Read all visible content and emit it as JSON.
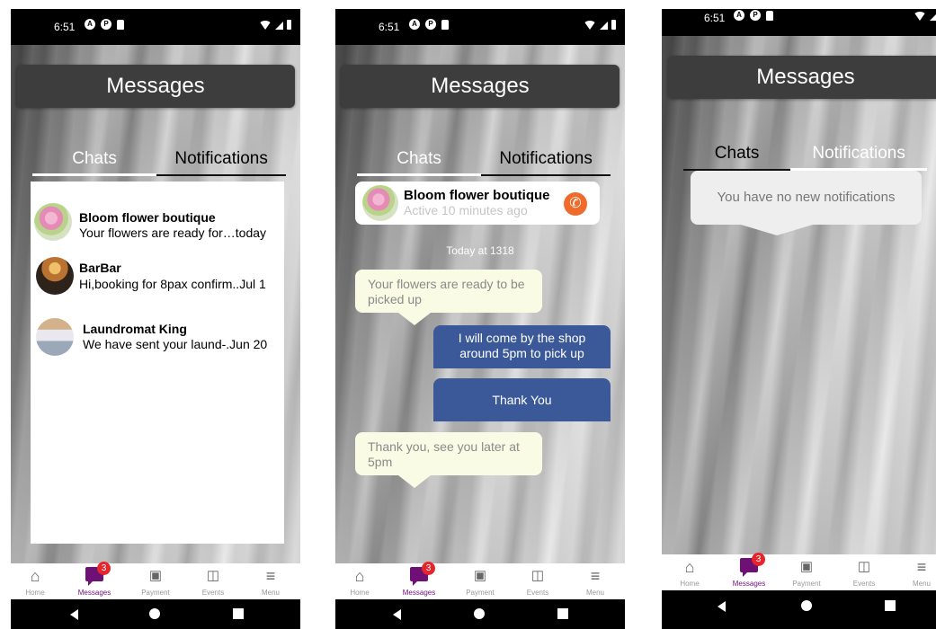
{
  "status_bar": {
    "time": "6:51",
    "icon_a": "A",
    "icon_p": "P"
  },
  "screens": {
    "chats_list": {
      "header_title": "Messages",
      "tabs": {
        "chats": "Chats",
        "notifications": "Notifications"
      },
      "chats": [
        {
          "name": "Bloom flower boutique",
          "snippet": "Your flowers are ready for…today",
          "avatar": "flower-avatar"
        },
        {
          "name": "BarBar",
          "snippet": "Hi,booking for 8pax confirm..Jul 1",
          "avatar": "bar-avatar"
        },
        {
          "name": "Laundromat King",
          "snippet": "We have sent your laund-.Jun 20",
          "avatar": "laundromat-avatar"
        }
      ]
    },
    "conversation": {
      "header_title": "Messages",
      "tabs": {
        "chats": "Chats",
        "notifications": "Notifications"
      },
      "contact": {
        "name": "Bloom flower boutique",
        "status": "Active 10 minutes ago",
        "call_icon": "phone-icon"
      },
      "timestamp": "Today at 1318",
      "messages": [
        {
          "direction": "incoming",
          "text": "Your flowers are ready to be picked up"
        },
        {
          "direction": "outgoing",
          "text": "I will come by the shop around 5pm to pick up"
        },
        {
          "direction": "outgoing",
          "text": "Thank You"
        },
        {
          "direction": "incoming",
          "text": "Thank you, see you later at 5pm"
        }
      ]
    },
    "notifications": {
      "header_title": "Messages",
      "tabs": {
        "chats": "Chats",
        "notifications": "Notifications"
      },
      "empty_message": "You have no new notifications"
    }
  },
  "bottom_nav": {
    "items": [
      {
        "label": "Home",
        "icon": "home-icon"
      },
      {
        "label": "Messages",
        "icon": "messages-icon",
        "badge": "3"
      },
      {
        "label": "Payment",
        "icon": "payment-icon"
      },
      {
        "label": "Events",
        "icon": "events-icon"
      },
      {
        "label": "Menu",
        "icon": "menu-icon"
      }
    ],
    "active": "Messages"
  },
  "colors": {
    "accent_purple": "#6f1077",
    "badge_red": "#e5252b",
    "call_orange": "#ef6a2b",
    "outgoing_bubble": "#3b5998",
    "incoming_bubble": "#fafbe4"
  }
}
